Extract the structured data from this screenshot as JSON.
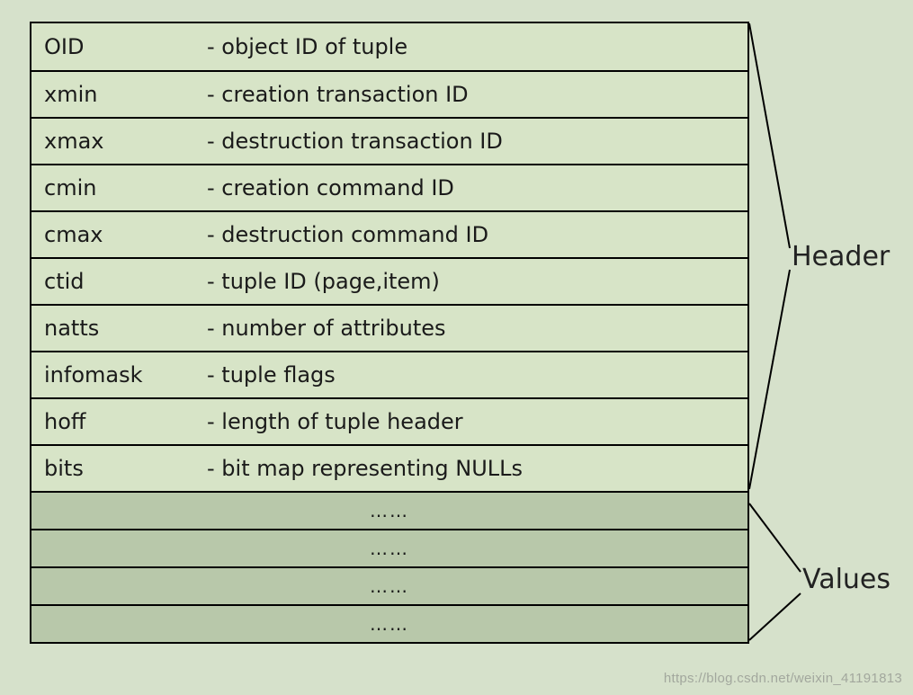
{
  "labels": {
    "header": "Header",
    "values": "Values"
  },
  "header_rows": [
    {
      "name": "OID",
      "desc": "- object ID of tuple"
    },
    {
      "name": "xmin",
      "desc": "- creation transaction ID"
    },
    {
      "name": "xmax",
      "desc": "- destruction transaction ID"
    },
    {
      "name": "cmin",
      "desc": "- creation command ID"
    },
    {
      "name": "cmax",
      "desc": "- destruction command ID"
    },
    {
      "name": "ctid",
      "desc": "- tuple ID (page,item)"
    },
    {
      "name": "natts",
      "desc": "- number of attributes"
    },
    {
      "name": "infomask",
      "desc": "- tuple flags"
    },
    {
      "name": "hoff",
      "desc": "- length of tuple header"
    },
    {
      "name": "bits",
      "desc": "-  bit map representing NULLs"
    }
  ],
  "value_rows": [
    {
      "text": "……"
    },
    {
      "text": "……"
    },
    {
      "text": "……"
    },
    {
      "text": "……"
    }
  ],
  "watermark": "https://blog.csdn.net/weixin_41191813"
}
